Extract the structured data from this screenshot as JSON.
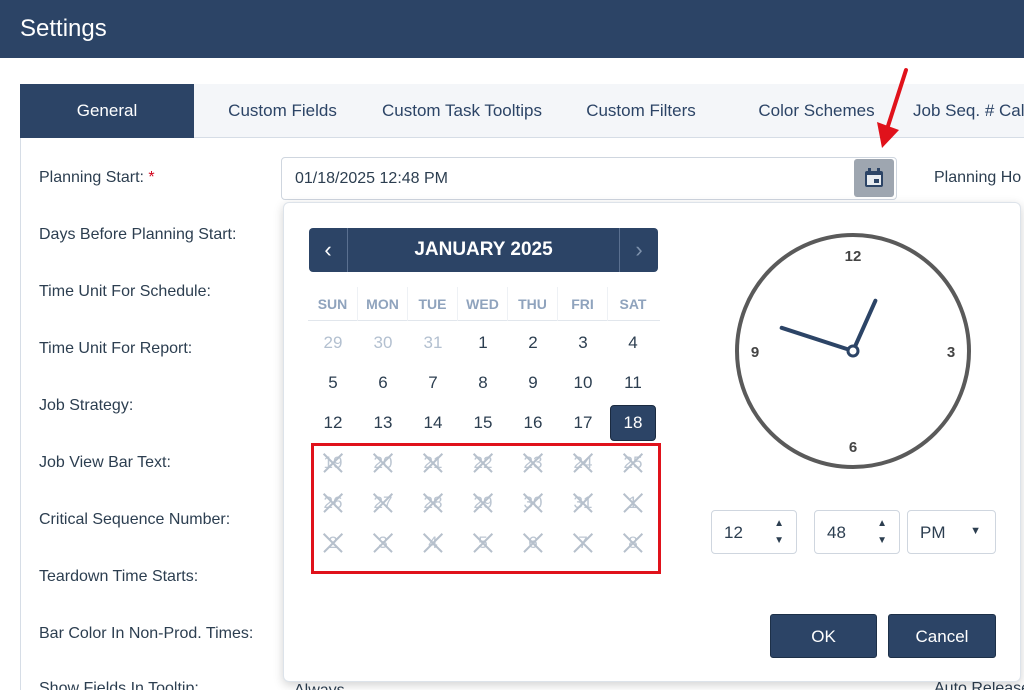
{
  "window": {
    "title": "Settings"
  },
  "tabs": [
    {
      "label": "General",
      "active": true
    },
    {
      "label": "Custom Fields"
    },
    {
      "label": "Custom Task Tooltips"
    },
    {
      "label": "Custom Filters"
    },
    {
      "label": "Color Schemes"
    },
    {
      "label": "Job Seq. # Cal"
    }
  ],
  "form": {
    "planning_start_label": "Planning Start:",
    "required_marker": "*",
    "planning_start_value": "01/18/2025 12:48 PM",
    "labels": [
      "Days Before Planning Start:",
      "Time Unit For Schedule:",
      "Time Unit For Report:",
      "Job Strategy:",
      "Job View Bar Text:",
      "Critical Sequence Number:",
      "Teardown Time Starts:",
      "Bar Color In Non-Prod. Times:",
      "Show Fields In Tooltip:"
    ],
    "show_fields_value": "Always",
    "right_labels": [
      "Planning Ho",
      "Auto Release"
    ]
  },
  "calendar": {
    "title": "JANUARY 2025",
    "prev_icon": "‹",
    "next_icon": "›",
    "weekdays": [
      "SUN",
      "MON",
      "TUE",
      "WED",
      "THU",
      "FRI",
      "SAT"
    ],
    "days": [
      [
        "29",
        "30",
        "31",
        "1",
        "2",
        "3",
        "4"
      ],
      [
        "5",
        "6",
        "7",
        "8",
        "9",
        "10",
        "11"
      ],
      [
        "12",
        "13",
        "14",
        "15",
        "16",
        "17",
        "18"
      ],
      [
        "19",
        "20",
        "21",
        "22",
        "23",
        "24",
        "25"
      ],
      [
        "26",
        "27",
        "28",
        "29",
        "30",
        "31",
        "1"
      ],
      [
        "2",
        "3",
        "4",
        "5",
        "6",
        "7",
        "8"
      ]
    ],
    "selected_day": "18"
  },
  "clock": {
    "numbers": [
      "12",
      "3",
      "6",
      "9"
    ],
    "hour": 12,
    "minute": 48
  },
  "time_picker": {
    "hour": "12",
    "minute": "48",
    "period": "PM"
  },
  "buttons": {
    "ok": "OK",
    "cancel": "Cancel"
  },
  "colors": {
    "primary": "#2c4466",
    "highlight": "#e0121b"
  }
}
